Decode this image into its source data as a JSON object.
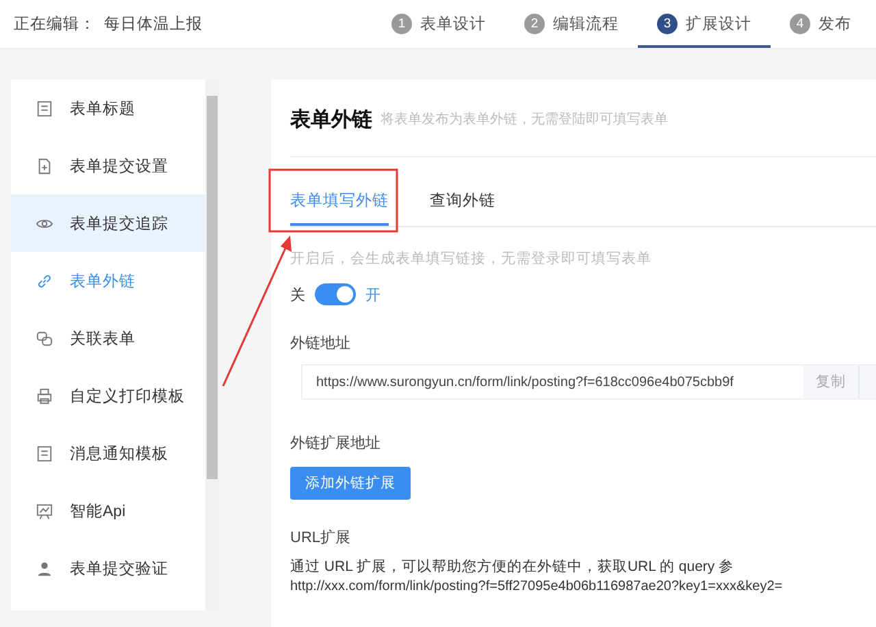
{
  "header": {
    "editing_label": "正在编辑：",
    "form_name": "每日体温上报"
  },
  "steps": [
    {
      "number": "1",
      "label": "表单设计",
      "selected": false
    },
    {
      "number": "2",
      "label": "编辑流程",
      "selected": false
    },
    {
      "number": "3",
      "label": "扩展设计",
      "selected": true
    },
    {
      "number": "4",
      "label": "发布",
      "selected": false
    }
  ],
  "sidebar": {
    "items": [
      {
        "label": "表单标题",
        "selected": false,
        "hovered": false
      },
      {
        "label": "表单提交设置",
        "selected": false,
        "hovered": false
      },
      {
        "label": "表单提交追踪",
        "selected": false,
        "hovered": true
      },
      {
        "label": "表单外链",
        "selected": true,
        "hovered": false
      },
      {
        "label": "关联表单",
        "selected": false,
        "hovered": false
      },
      {
        "label": "自定义打印模板",
        "selected": false,
        "hovered": false
      },
      {
        "label": "消息通知模板",
        "selected": false,
        "hovered": false
      },
      {
        "label": "智能Api",
        "selected": false,
        "hovered": false
      },
      {
        "label": "表单提交验证",
        "selected": false,
        "hovered": false
      }
    ]
  },
  "panel": {
    "title": "表单外链",
    "subtitle": "将表单发布为表单外链，无需登陆即可填写表单",
    "tabs": [
      {
        "label": "表单填写外链",
        "selected": true
      },
      {
        "label": "查询外链",
        "selected": false
      }
    ],
    "hint": "开启后，会生成表单填写链接，无需登录即可填写表单",
    "toggle": {
      "off_label": "关",
      "on_label": "开",
      "on": true
    },
    "link_label": "外链地址",
    "link_value": "https://www.surongyun.cn/form/link/posting?f=618cc096e4b075cbb9f",
    "copy_button": "复制",
    "extension_label": "外链扩展地址",
    "add_button": "添加外链扩展",
    "url_heading": "URL扩展",
    "url_text": "通过 URL 扩展，可以帮助您方便的在外链中，获取URL 的 query 参",
    "url_example": "http://xxx.com/form/link/posting?f=5ff27095e4b06b116987ae20?key1=xxx&key2="
  }
}
